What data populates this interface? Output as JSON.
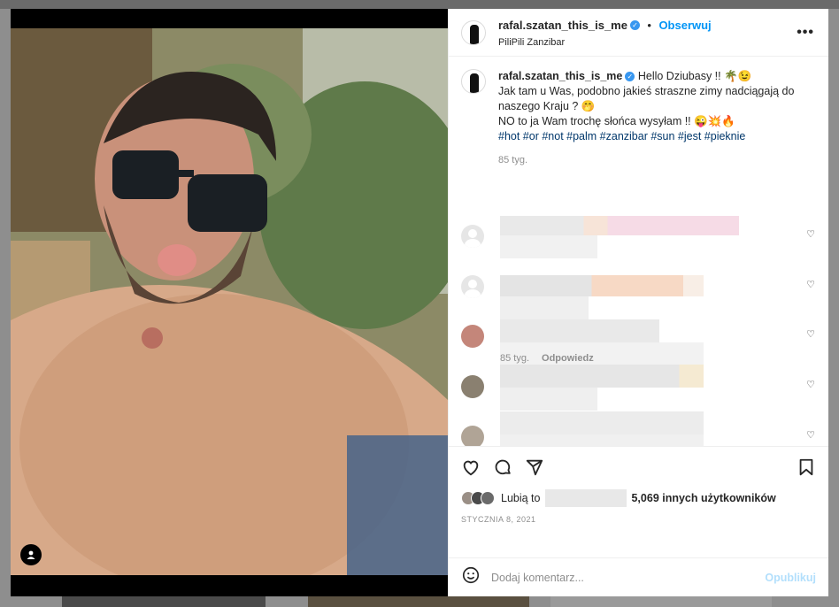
{
  "post": {
    "username": "rafal.szatan_this_is_me",
    "follow_label": "Obserwuj",
    "location": "PiliPili Zanzibar",
    "more_label": "•••"
  },
  "caption": {
    "username": "rafal.szatan_this_is_me",
    "line1": "Hello Dziubasy !! 🌴😉",
    "line2": "Jak tam u Was, podobno jakieś straszne zimy nadciągają do naszego Kraju ? 🤭",
    "line3": "NO to ja Wam trochę słońca wysyłam !! 😜💥🔥",
    "hashtags": "#hot #or #not #palm #zanzibar #sun #jest #pieknie",
    "age": "85 tyg."
  },
  "comments": [
    {
      "heart": "♡"
    },
    {
      "heart": "♡"
    },
    {
      "heart": "♡"
    },
    {
      "heart": "♡"
    },
    {
      "heart": "♡"
    },
    {
      "heart": "♡"
    }
  ],
  "last_comment": {
    "age": "85 tyg.",
    "reply_label": "Odpowiedz"
  },
  "likes": {
    "prefix": "Lubią to",
    "others": "5,069 innych użytkowników"
  },
  "date": "STYCZNIA 8, 2021",
  "add_comment": {
    "placeholder": "Dodaj komentarz...",
    "publish_label": "Opublikuj"
  },
  "colors": {
    "accent": "#0095f6",
    "link": "#00376b",
    "muted": "#8e8e8e"
  }
}
